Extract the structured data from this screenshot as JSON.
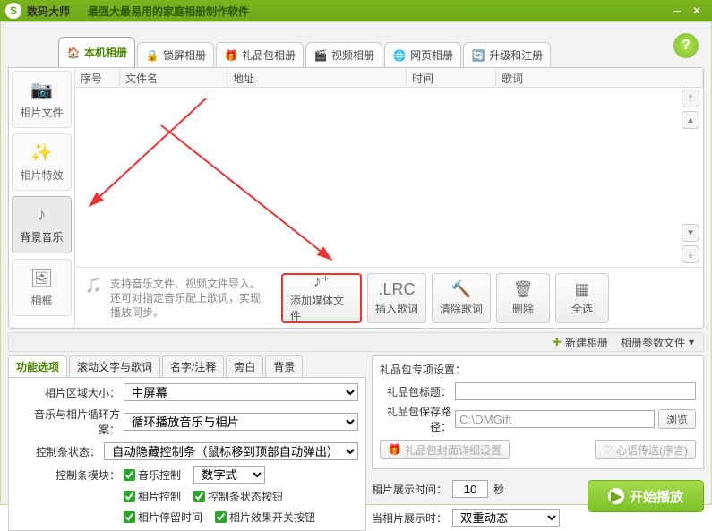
{
  "titlebar": {
    "logo": "S",
    "app": "数码大师",
    "sub": "最强大最易用的家庭相册制作软件"
  },
  "tabs": [
    {
      "label": "本机相册",
      "icon": "🏠"
    },
    {
      "label": "锁屏相册",
      "icon": "🔒"
    },
    {
      "label": "礼品包相册",
      "icon": "🎁"
    },
    {
      "label": "视频相册",
      "icon": "🎬"
    },
    {
      "label": "网页相册",
      "icon": "🌐"
    },
    {
      "label": "升级和注册",
      "icon": "🔄"
    }
  ],
  "sidebar": [
    {
      "label": "相片文件",
      "icon": "📷"
    },
    {
      "label": "相片特效",
      "icon": "✨"
    },
    {
      "label": "背景音乐",
      "icon": "♪"
    },
    {
      "label": "相框",
      "icon": "🖼"
    }
  ],
  "list_headers": {
    "num": "序号",
    "file": "文件名",
    "addr": "地址",
    "time": "时间",
    "lyric": "歌词"
  },
  "hint": {
    "line1": "支持音乐文件、视频文件导入。",
    "line2": "还可对指定音乐配上歌词，实现",
    "line3": "播放同步。"
  },
  "actions": {
    "add": "添加媒体文件",
    "lrc": ".LRC",
    "insert": "插入歌词",
    "clear": "清除歌词",
    "delete": "删除",
    "selectall": "全选"
  },
  "strip": {
    "newalbum": "新建相册",
    "params": "相册参数文件"
  },
  "subtabs": [
    "功能选项",
    "滚动文字与歌词",
    "名字/注释",
    "旁白",
    "背景"
  ],
  "form": {
    "area_label": "相片区域大小：",
    "area_value": "中屏幕",
    "loop_label": "音乐与相片循环方案：",
    "loop_value": "循环播放音乐与相片",
    "ctrl_label": "控制条状态：",
    "ctrl_value": "自动隐藏控制条（鼠标移到顶部自动弹出）",
    "module_label": "控制条模块：",
    "cb_music": "音乐控制",
    "cb_numstyle": "数字式",
    "cb_photo": "相片控制",
    "cb_ctrlstate": "控制条状态按钮",
    "cb_stay": "相片停留时间",
    "cb_effect": "相片效果开关按钮"
  },
  "gift": {
    "group": "礼品包专项设置：",
    "title_label": "礼品包标题：",
    "title_value": "",
    "path_label": "礼品包保存路径：",
    "path_value": "C:\\DMGift",
    "browse": "浏览",
    "detail": "礼品包封面详细设置",
    "wish": "心语传送(序言)"
  },
  "show": {
    "time_label": "相片展示时间：",
    "time_value": "10",
    "sec": "秒",
    "mode_label": "当相片展示时：",
    "mode_value": "双重动态"
  },
  "play": "开始播放"
}
